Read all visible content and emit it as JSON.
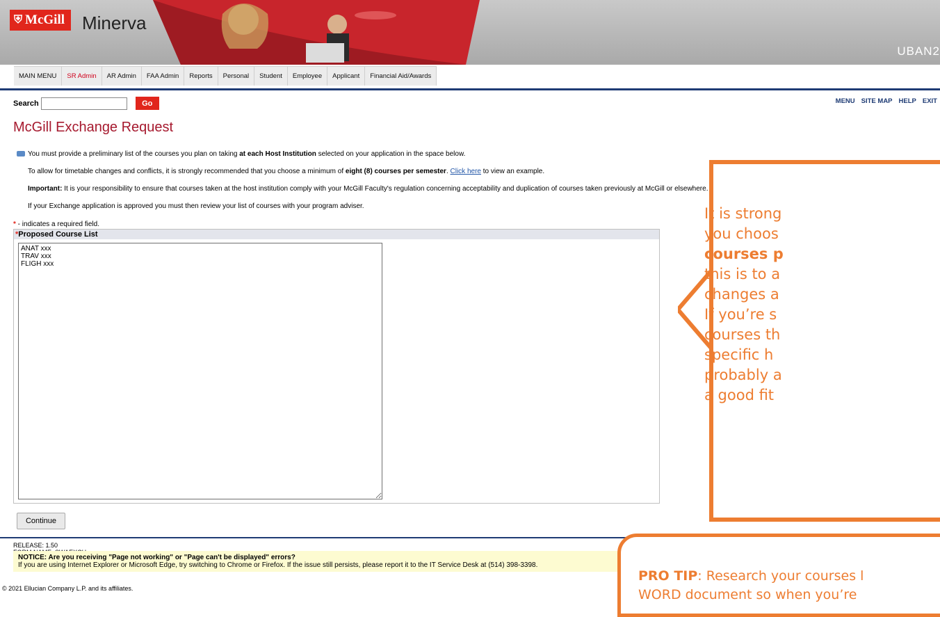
{
  "header": {
    "logo_text": "McGill",
    "app_name": "Minerva",
    "user_id": "UBAN2"
  },
  "nav": {
    "tabs": [
      "MAIN MENU",
      "SR Admin",
      "AR Admin",
      "FAA Admin",
      "Reports",
      "Personal",
      "Student",
      "Employee",
      "Applicant",
      "Financial Aid/Awards"
    ],
    "active_tab": "SR Admin"
  },
  "search": {
    "label": "Search",
    "value": "",
    "go_label": "Go"
  },
  "toplinks": [
    "MENU",
    "SITE MAP",
    "HELP",
    "EXIT"
  ],
  "page": {
    "title": "McGill Exchange Request",
    "info1_a": "You must provide a preliminary list of the courses you plan on taking ",
    "info1_b": "at each Host Institution",
    "info1_c": " selected on your application in the space below.",
    "info2_a": "To allow for timetable changes and conflicts, it is strongly recommended that you choose a minimum of ",
    "info2_b": "eight (8) courses per semester",
    "info2_c": ". ",
    "info2_link": "Click here",
    "info2_d": " to view an example.",
    "info3_a": "Important:",
    "info3_b": " It is your responsibility to ensure that courses taken at the host institution comply with your McGill Faculty's regulation concerning acceptability and duplication of courses taken previously at McGill or elsewhere.",
    "info4": "If your Exchange application is approved you must then review your list of courses with your program adviser.",
    "required_note": " - indicates a required field.",
    "course_list_label": "Proposed Course List",
    "course_list_value": "ANAT xxx\nTRAV xxx\nFLIGH xxx",
    "continue_label": "Continue"
  },
  "footer": {
    "release": "RELEASE: 1.50",
    "form_name": "FORM NAME: SWAEXCH",
    "notice_title": "NOTICE: Are you receiving \"Page not working\" or \"Page can't be displayed\" errors?",
    "notice_body": "If you are using Internet Explorer or Microsoft Edge, try switching to Chrome or Firefox. If the issue still persists, please report it to the IT Service Desk at (514) 398-3398.",
    "copyright": "© 2021 Ellucian Company L.P. and its affiliates."
  },
  "callout": {
    "line1": "It is strong",
    "line2": "you choos",
    "line3": "courses p",
    "line4": "this is to a",
    "line5": "changes a",
    "line6": "If you’re s",
    "line7": "courses th",
    "line8": "specific h",
    "line9": "probably a",
    "line10": "a good fit",
    "color": "#ed7d31"
  },
  "protip": {
    "label": "PRO TIP",
    "text1": ": Research your courses l",
    "text2": "WORD document so when you’re"
  },
  "colors": {
    "brand_red": "#e1261c",
    "nav_blue": "#1e3b74",
    "title_red": "#a6192e",
    "orange": "#ed7d31"
  }
}
